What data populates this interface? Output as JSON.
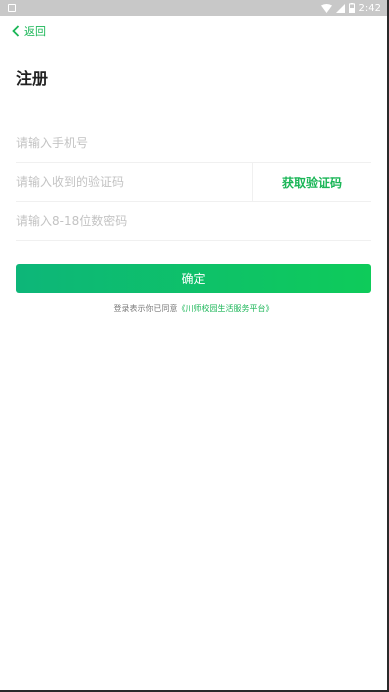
{
  "status_bar": {
    "time": "2:42"
  },
  "nav": {
    "back_label": "返回"
  },
  "page": {
    "title": "注册"
  },
  "form": {
    "phone_placeholder": "请输入手机号",
    "code_placeholder": "请输入收到的验证码",
    "get_code_label": "获取验证码",
    "password_placeholder": "请输入8-18位数密码",
    "submit_label": "确定"
  },
  "agreement": {
    "prefix": "登录表示你已同意",
    "link_text": "《川师校园生活服务平台》"
  },
  "colors": {
    "accent": "#1ab657",
    "button_start": "#0db679",
    "button_end": "#0ecb5a"
  }
}
